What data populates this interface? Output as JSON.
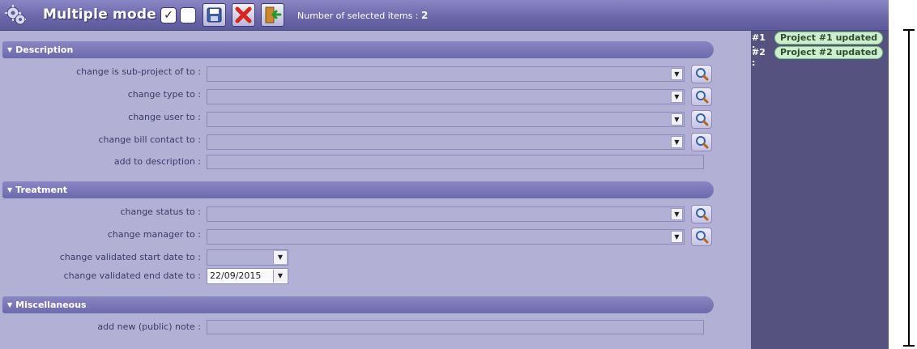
{
  "header": {
    "title": "Multiple mode",
    "selected_count_label": "Number of selected items : ",
    "selected_count": "2",
    "check_all_label": "✓",
    "uncheck_all_label": ""
  },
  "sections": {
    "description": {
      "title": "Description",
      "fields": {
        "subproject": {
          "label": "change is sub-project of to :",
          "value": ""
        },
        "type": {
          "label": "change type to :",
          "value": ""
        },
        "user": {
          "label": "change user to :",
          "value": ""
        },
        "bill_contact": {
          "label": "change bill contact to :",
          "value": ""
        },
        "description": {
          "label": "add to description :",
          "value": ""
        }
      }
    },
    "treatment": {
      "title": "Treatment",
      "fields": {
        "status": {
          "label": "change status to :",
          "value": ""
        },
        "manager": {
          "label": "change manager to :",
          "value": ""
        },
        "start_date": {
          "label": "change validated start date to :",
          "value": ""
        },
        "end_date": {
          "label": "change validated end date to :",
          "value": "22/09/2015"
        }
      }
    },
    "misc": {
      "title": "Miscellaneous",
      "fields": {
        "note": {
          "label": "add new (public) note :",
          "value": ""
        }
      }
    }
  },
  "results": [
    {
      "num": "#1 :",
      "text": "Project #1 updated"
    },
    {
      "num": "#2 :",
      "text": "Project #2 updated"
    }
  ],
  "icons": {
    "gear": "gear-icon",
    "save": "save-icon",
    "cancel": "cancel-icon",
    "exit": "exit-icon",
    "search": "search-icon"
  },
  "colors": {
    "header": "#6b66a8",
    "panel": "#b3b0d6",
    "result_panel": "#55527f",
    "result_badge": "#cdeecf"
  }
}
